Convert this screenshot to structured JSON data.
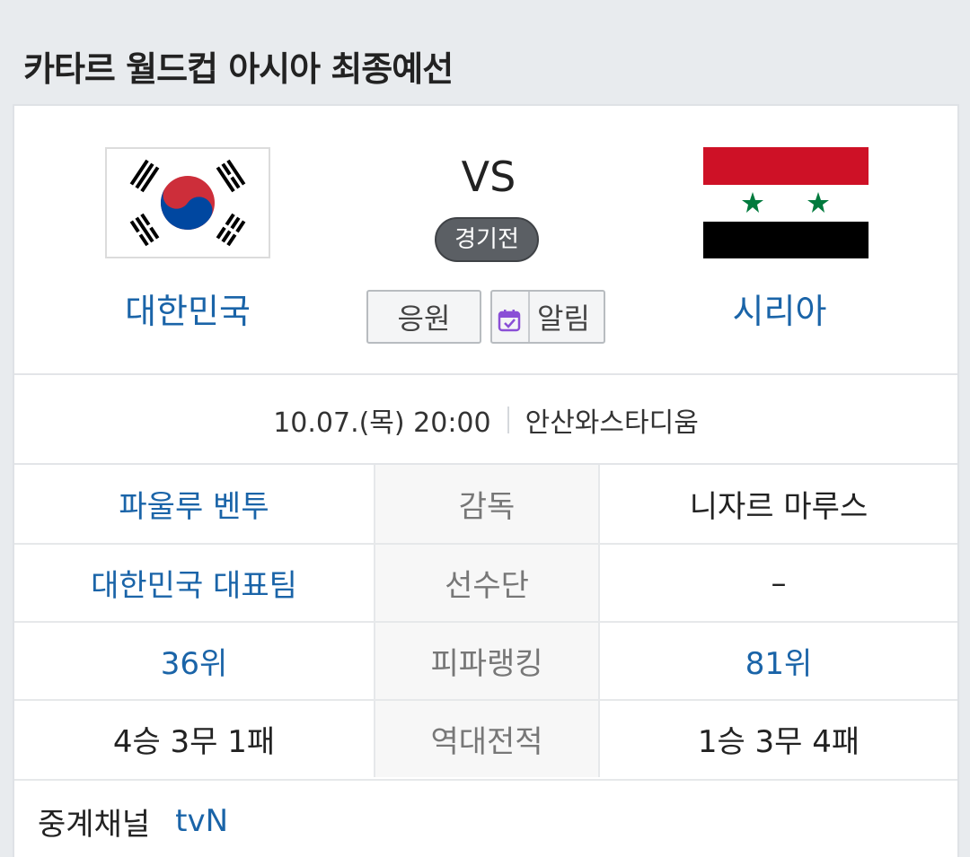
{
  "page": {
    "title": "카타르 월드컵 아시아 최종예선"
  },
  "match": {
    "home_team": "대한민국",
    "away_team": "시리아",
    "vs_label": "VS",
    "status": "경기전",
    "cheer_label": "응원",
    "alarm_label": "알림",
    "date_time": "10.07.(목) 20:00",
    "venue": "안산와스타디움"
  },
  "stats": [
    {
      "label": "감독",
      "home": "파울루 벤투",
      "away": "니자르 마루스"
    },
    {
      "label": "선수단",
      "home": "대한민국 대표팀",
      "away": "–"
    },
    {
      "label": "피파랭킹",
      "home": "36위",
      "away": "81위"
    },
    {
      "label": "역대전적",
      "home": "4승 3무 1패",
      "away": "1승 3무 4패"
    }
  ],
  "broadcast": {
    "label": "중계채널",
    "value": "tvN"
  },
  "colors": {
    "link_blue": "#1a64a8",
    "badge_gray": "#5b5f64",
    "syria_red": "#ce1126",
    "syria_green": "#007a3d",
    "kr_red": "#cd2e3a",
    "kr_blue": "#0047a0"
  }
}
